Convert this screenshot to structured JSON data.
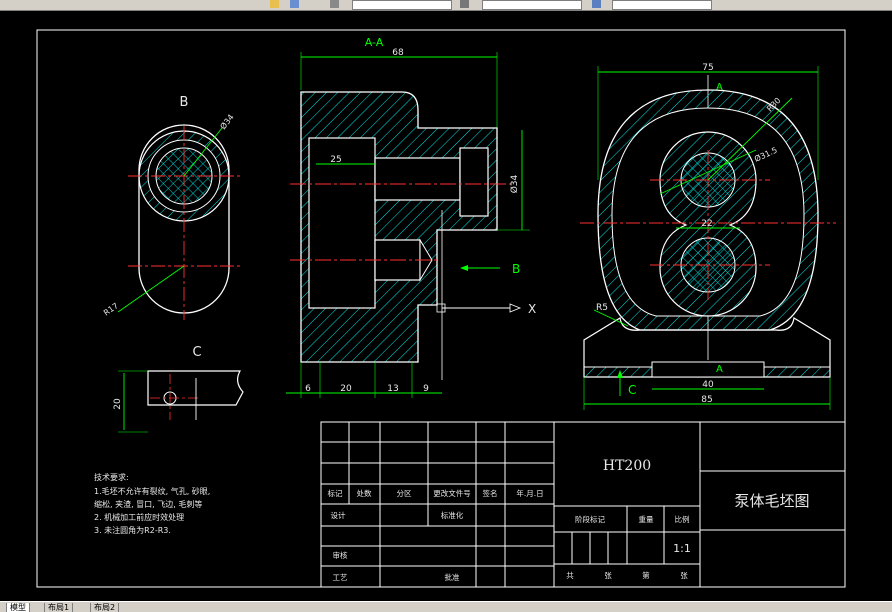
{
  "toolbar": {
    "icons": [
      "zoom-icon",
      "layer-icon",
      "match-prop-icon",
      "properties-icon",
      "layer-list-icon"
    ]
  },
  "tabs": [
    {
      "label": "模型"
    },
    {
      "label": "布局1"
    },
    {
      "label": "布局2"
    }
  ],
  "views": {
    "section_title": "A-A",
    "left": {
      "label_top": "B",
      "label_bottom": "C",
      "dim_dia": "Ø34",
      "dim_radius": "R17"
    },
    "section": {
      "dim_total": "68",
      "dim_inner": "25",
      "dim_dia": "Ø34",
      "dim_bottom": [
        "6",
        "20",
        "13",
        "9"
      ],
      "arrow_b": "B",
      "axis_x": "X"
    },
    "right": {
      "dim_width": "75",
      "dim_r30": "R30",
      "dim_dia": "Ø31.5",
      "dim_center": "22",
      "dim_r5": "R5",
      "dim_base_inner": "40",
      "dim_base": "85",
      "label_a_top": "A",
      "label_a_bottom": "A",
      "label_c": "C"
    },
    "c_view": {
      "dim_height": "20"
    }
  },
  "notes": {
    "title": "技术要求:",
    "lines": [
      "1.毛坯不允许有裂纹, 气孔, 砂眼,",
      "缩松, 夹渣, 冒口, 飞边, 毛刺等",
      "2. 机械加工前应时效处理",
      "3. 未注圆角为R2-R3."
    ]
  },
  "title_block": {
    "material": "HT200",
    "part_name": "泵体毛坯图",
    "scale": "1:1",
    "row_labels": [
      "标记",
      "处数",
      "分区",
      "更改文件号",
      "签名",
      "年.月.日"
    ],
    "design": "设计",
    "standard": "标准化",
    "stage": "阶段标记",
    "weight": "重量",
    "scale_label": "比例",
    "review": "审核",
    "process": "工艺",
    "approve": "批准",
    "sheets": [
      "共",
      "张",
      "第",
      "张"
    ]
  }
}
